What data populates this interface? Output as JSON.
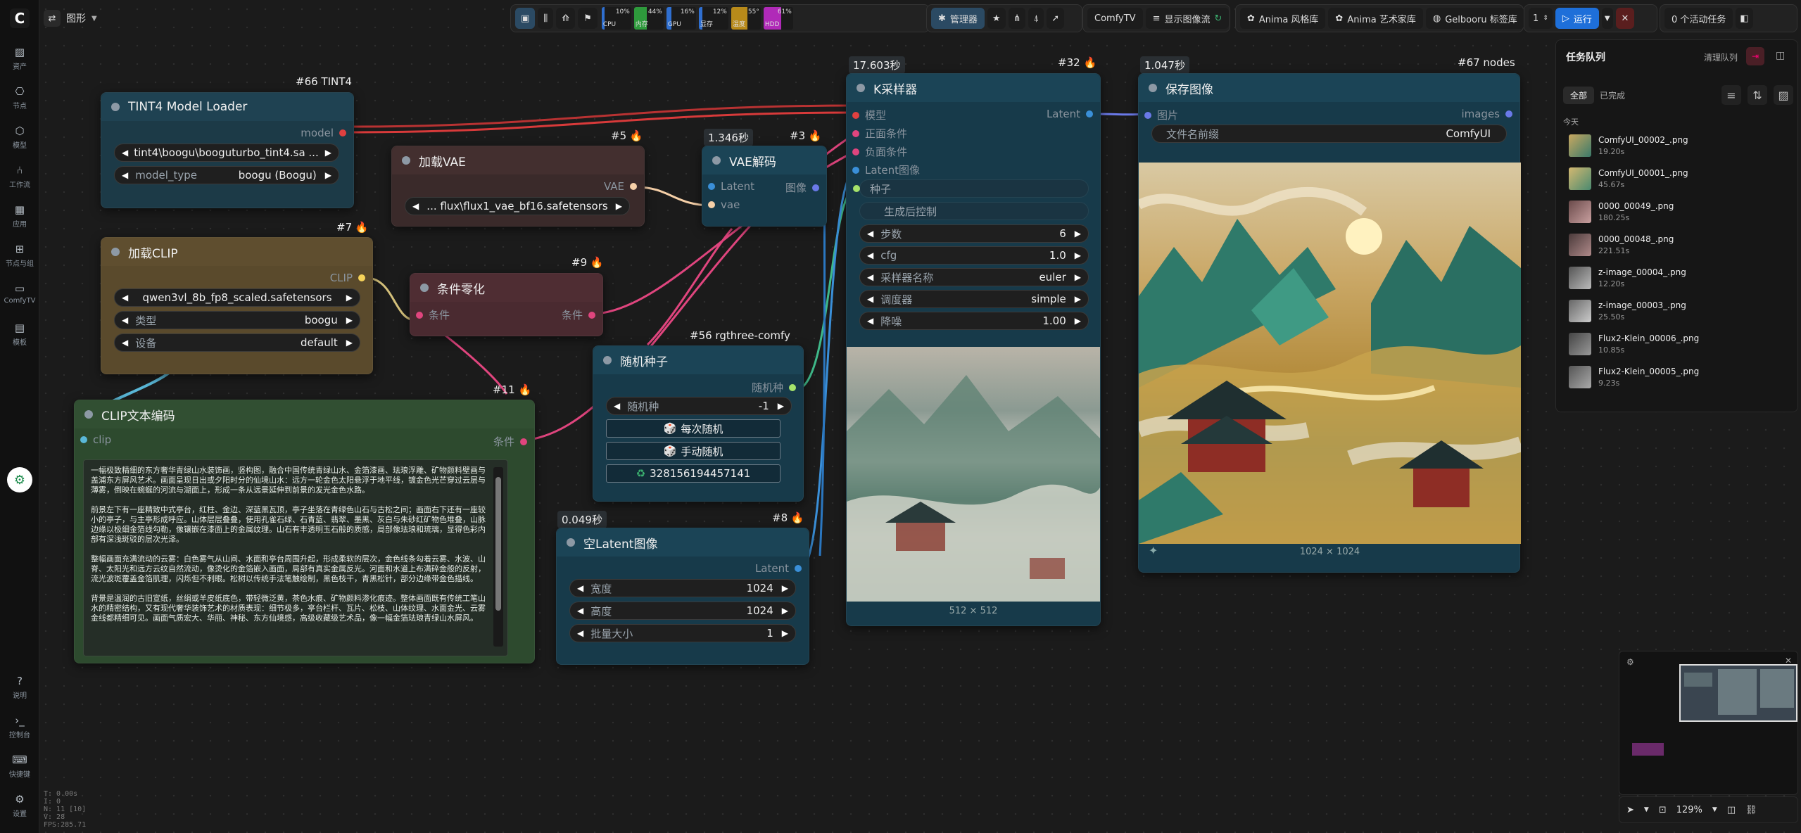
{
  "workspace": {
    "title": "图形"
  },
  "rail": {
    "items": [
      {
        "label": "资产",
        "icon": "image-icon"
      },
      {
        "label": "节点",
        "icon": "nodes-icon"
      },
      {
        "label": "模型",
        "icon": "cube-icon"
      },
      {
        "label": "工作流",
        "icon": "workflow-icon"
      },
      {
        "label": "应用",
        "icon": "app-icon"
      },
      {
        "label": "节点与组",
        "icon": "group-icon"
      },
      {
        "label": "ComfyTV",
        "icon": "tv-icon"
      },
      {
        "label": "模板",
        "icon": "template-icon"
      }
    ],
    "bottom": [
      {
        "label": "说明",
        "icon": "help-icon"
      },
      {
        "label": "控制台",
        "icon": "terminal-icon"
      },
      {
        "label": "快捷键",
        "icon": "keyboard-icon"
      },
      {
        "label": "设置",
        "icon": "gear-icon"
      }
    ],
    "stats": [
      "T: 0.00s",
      "I: 0",
      "N: 11 [10]",
      "V: 28",
      "FPS:285.71"
    ]
  },
  "topbar": {
    "meters": [
      {
        "label": "CPU",
        "value": "10%",
        "fill": 0.1,
        "color": "#2f6fd0"
      },
      {
        "label": "内存",
        "value": "44%",
        "fill": 0.44,
        "color": "#2e9a3c"
      },
      {
        "label": "GPU",
        "value": "16%",
        "fill": 0.16,
        "color": "#2f6fd0"
      },
      {
        "label": "显存",
        "value": "12%",
        "fill": 0.12,
        "color": "#2f6fd0"
      },
      {
        "label": "温度",
        "value": "55°",
        "fill": 0.55,
        "color": "#b88a1a"
      },
      {
        "label": "HDD",
        "value": "61%",
        "fill": 0.61,
        "color": "#b02ab8"
      }
    ],
    "manager": "管理器",
    "comfytv": "ComfyTV",
    "show_stream": "显示图像流",
    "anima_style": "Anima 风格库",
    "anima_artist": "Anima 艺术家库",
    "gelbooru": "Gelbooru 标签库",
    "queue_count": "1",
    "run": "运行",
    "active_tasks": "0 个活动任务"
  },
  "queue": {
    "title": "任务队列",
    "clear": "清理队列",
    "tabs": [
      "全部",
      "已完成"
    ],
    "today": "今天",
    "items": [
      {
        "name": "ComfyUI_00002_.png",
        "time": "19.20s"
      },
      {
        "name": "ComfyUI_00001_.png",
        "time": "45.67s"
      },
      {
        "name": "0000_00049_.png",
        "time": "180.25s"
      },
      {
        "name": "0000_00048_.png",
        "time": "221.51s"
      },
      {
        "name": "z-image_00004_.png",
        "time": "12.20s"
      },
      {
        "name": "z-image_00003_.png",
        "time": "25.50s"
      },
      {
        "name": "Flux2-Klein_00006_.png",
        "time": "10.85s"
      },
      {
        "name": "Flux2-Klein_00005_.png",
        "time": "9.23s"
      }
    ]
  },
  "nodes": {
    "tint4": {
      "badge": "#66 TINT4",
      "title": "TINT4 Model Loader",
      "out": "model",
      "w1": "tint4\\boogu\\booguturbo_tint4.sa ...",
      "w2_label": "model_type",
      "w2_value": "boogu (Boogu)"
    },
    "vae": {
      "badge": "#5",
      "title": "加载VAE",
      "out": "VAE",
      "w1": "... flux\\flux1_vae_bf16.safetensors"
    },
    "clip": {
      "badge": "#7",
      "title": "加载CLIP",
      "out": "CLIP",
      "w1": "qwen3vl_8b_fp8_scaled.safetensors",
      "w2_label": "类型",
      "w2_value": "boogu",
      "w3_label": "设备",
      "w3_value": "default"
    },
    "zero": {
      "badge": "#9",
      "title": "条件零化",
      "in": "条件",
      "out": "条件"
    },
    "vaedec": {
      "badge": "#3",
      "timer": "1.346秒",
      "title": "VAE解码",
      "in1": "Latent",
      "in2": "vae",
      "out": "图像"
    },
    "seed": {
      "badge": "#56 rgthree-comfy",
      "title": "随机种子",
      "out": "随机种",
      "w1_label": "随机种",
      "w1_value": "-1",
      "b1": "每次随机",
      "b2": "手动随机",
      "b3": "328156194457141"
    },
    "cliptext": {
      "badge": "#11",
      "title": "CLIP文本编码",
      "in": "clip",
      "out": "条件",
      "prompt": [
        "一幅极致精细的东方奢华青绿山水装饰画，竖构图，融合中国传统青绿山水、金箔漆画、珐琅浮雕、矿物颜料壁画与盖浦东方屏风艺术。画面呈现日出或夕阳时分的仙境山水：远方一轮金色太阳悬浮于地平线，镀金色光芒穿过云层与薄雾，倒映在蜿蜒的河流与湖面上，形成一条从远景延伸到前景的发光金色水路。",
        "前景左下有一座精致中式亭台，红柱、金边、深蓝黑瓦顶，亭子坐落在青绿色山石与古松之间；画面右下还有一座较小的亭子，与主亭形成呼应。山体层层叠叠，使用孔雀石绿、石青蓝、翡翠、墨黑、灰白与朱砂红矿物色堆叠，山脉边缘以极细金箔线勾勒，像镶嵌在漆面上的金属纹理。山石有丰透明玉石般的质感，局部像珐琅和琉璃，显得色彩内部有深浅斑驳的层次光泽。",
        "整幅画面充满流动的云雾：白色雾气从山间、水面和亭台周围升起，形成柔软的层次，金色线条勾着云雾、水波、山脊、太阳光和远方云纹自然流动，像烫化的金箔嵌入画面，局部有真实金属反光。河面和水道上布满碎金般的反射，流光波斑覆盖金箔肌理，闪烁但不刺眼。松树以传统手法笔触绘制，黑色枝干，青黑松针，部分边缘带金色描线。",
        "背景是温润的古旧宣纸，丝绢或羊皮纸底色，带轻微泛黄，茶色水痕、矿物颜料渗化痕迹。整体画面既有传统工笔山水的精密结构，又有现代奢华装饰艺术的材质表现：细节极多，亭台栏杆、瓦片、松枝、山体纹理、水面金光、云雾金线都精细可见。画面气质宏大、华丽、神秘、东方仙境感，高级收藏级艺术品，像一幅金箔珐琅青绿山水屏风。"
      ]
    },
    "latent": {
      "badge": "#8",
      "timer": "0.049秒",
      "title": "空Latent图像",
      "out": "Latent",
      "w1_label": "宽度",
      "w1_value": "1024",
      "w2_label": "高度",
      "w2_value": "1024",
      "w3_label": "批量大小",
      "w3_value": "1"
    },
    "ksampler": {
      "badge": "#32",
      "timer": "17.603秒",
      "title": "K采样器",
      "out": "Latent",
      "in": [
        "模型",
        "正面条件",
        "负面条件",
        "Latent图像",
        "种子"
      ],
      "ctrl": "生成后控制",
      "widgets": [
        {
          "label": "步数",
          "value": "6"
        },
        {
          "label": "cfg",
          "value": "1.0"
        },
        {
          "label": "采样器名称",
          "value": "euler"
        },
        {
          "label": "调度器",
          "value": "simple"
        },
        {
          "label": "降噪",
          "value": "1.00"
        }
      ],
      "dim": "512 × 512"
    },
    "save": {
      "badge": "#67 nodes",
      "timer": "1.047秒",
      "title": "保存图像",
      "in": "图片",
      "out": "images",
      "w_label": "文件名前缀",
      "w_value": "ComfyUI",
      "dim": "1024 × 1024"
    }
  },
  "minimap": {
    "zoom": "129%"
  }
}
